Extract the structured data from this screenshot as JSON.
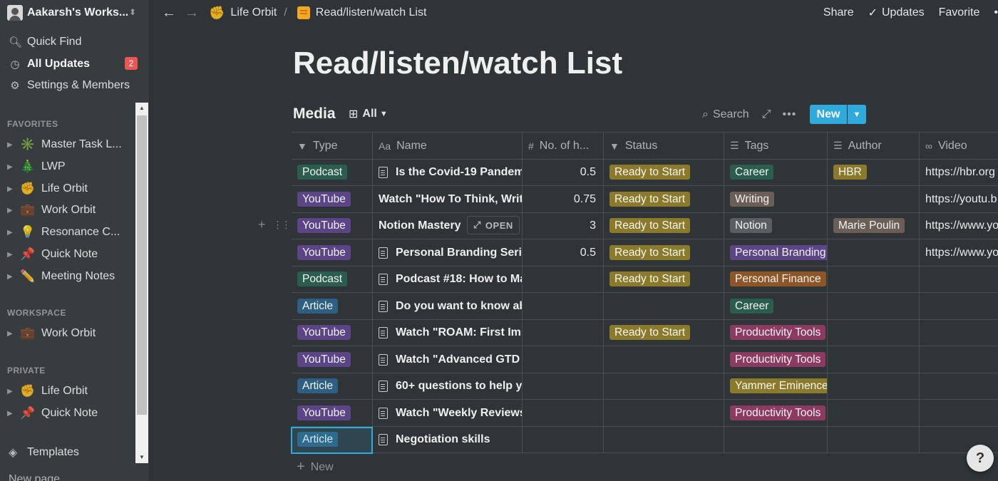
{
  "sidebar": {
    "workspace_name": "Aakarsh's Works...",
    "top_items": [
      {
        "label": "Quick Find",
        "icon": "search-icon"
      },
      {
        "label": "All Updates",
        "icon": "clock-icon",
        "badge": "2"
      },
      {
        "label": "Settings & Members",
        "icon": "gear-icon"
      }
    ],
    "favorites_label": "FAVORITES",
    "favorites": [
      {
        "emoji": "✳️",
        "label": "Master Task L..."
      },
      {
        "emoji": "🎄",
        "label": "LWP"
      },
      {
        "emoji": "✊",
        "label": "Life Orbit"
      },
      {
        "emoji": "💼",
        "label": "Work Orbit"
      },
      {
        "emoji": "💡",
        "label": "Resonance C..."
      },
      {
        "emoji": "📌",
        "label": "Quick Note"
      },
      {
        "emoji": "✏️",
        "label": "Meeting Notes"
      }
    ],
    "workspace_label": "WORKSPACE",
    "workspace_pages": [
      {
        "emoji": "💼",
        "label": "Work Orbit"
      }
    ],
    "private_label": "PRIVATE",
    "private_pages": [
      {
        "emoji": "✊",
        "label": "Life Orbit"
      },
      {
        "emoji": "📌",
        "label": "Quick Note"
      }
    ],
    "templates_label": "Templates",
    "new_page_label": "New page"
  },
  "topbar": {
    "breadcrumb_1": {
      "emoji": "✊",
      "label": "Life Orbit"
    },
    "separator": "/",
    "breadcrumb_2": {
      "label": "Read/listen/watch List"
    },
    "share": "Share",
    "updates": "Updates",
    "favorite": "Favorite",
    "more": "•"
  },
  "page": {
    "title": "Read/listen/watch List",
    "database_title": "Media",
    "view_name": "All",
    "search_label": "Search",
    "new_button": "New",
    "add_new_row": "New"
  },
  "table": {
    "columns": [
      {
        "label": "Type",
        "icon": "select-icon"
      },
      {
        "label": "Name",
        "icon": "text-icon"
      },
      {
        "label": "No. of h...",
        "icon": "number-icon"
      },
      {
        "label": "Status",
        "icon": "select-icon"
      },
      {
        "label": "Tags",
        "icon": "list-icon"
      },
      {
        "label": "Author",
        "icon": "list-icon"
      },
      {
        "label": "Video",
        "icon": "link-icon"
      }
    ],
    "open_label": "OPEN",
    "rows": [
      {
        "type": "Podcast",
        "name": "Is the Covid-19 Pandemi",
        "hours": "0.5",
        "status": "Ready to Start",
        "tags": "Career",
        "author": "HBR",
        "video": "https://hbr.org",
        "doc": true
      },
      {
        "type": "YouTube",
        "name": "Watch \"How To Think, Write",
        "hours": "0.75",
        "status": "Ready to Start",
        "tags": "Writing",
        "author": "",
        "video": "https://youtu.b",
        "doc": false
      },
      {
        "type": "YouTube",
        "name": "Notion Mastery",
        "hours": "3",
        "status": "Ready to Start",
        "tags": "Notion",
        "author": "Marie Poulin",
        "video": "https://www.yo",
        "doc": false
      },
      {
        "type": "YouTube",
        "name": "Personal Branding Series",
        "hours": "0.5",
        "status": "Ready to Start",
        "tags": "Personal Branding",
        "author": "",
        "video": "https://www.yo",
        "doc": true
      },
      {
        "type": "Podcast",
        "name": "Podcast #18: How to Ma",
        "hours": "",
        "status": "Ready to Start",
        "tags": "Personal Finance",
        "author": "",
        "video": "",
        "doc": true
      },
      {
        "type": "Article",
        "name": "Do you want to know ab",
        "hours": "",
        "status": "",
        "tags": "Career",
        "author": "",
        "video": "",
        "doc": true
      },
      {
        "type": "YouTube",
        "name": "Watch \"ROAM: First Imp",
        "hours": "",
        "status": "Ready to Start",
        "tags": "Productivity Tools",
        "author": "",
        "video": "",
        "doc": true
      },
      {
        "type": "YouTube",
        "name": "Watch \"Advanced GTD D",
        "hours": "",
        "status": "",
        "tags": "Productivity Tools",
        "author": "",
        "video": "",
        "doc": true
      },
      {
        "type": "Article",
        "name": "60+ questions to help yo",
        "hours": "",
        "status": "",
        "tags": "Yammer Eminence",
        "author": "",
        "video": "",
        "doc": true
      },
      {
        "type": "YouTube",
        "name": "Watch \"Weekly Reviews",
        "hours": "",
        "status": "",
        "tags": "Productivity Tools",
        "author": "",
        "video": "",
        "doc": true
      },
      {
        "type": "Article",
        "name": "Negotiation skills",
        "hours": "",
        "status": "",
        "tags": "",
        "author": "",
        "video": "",
        "doc": true
      }
    ]
  },
  "colors": {
    "Podcast": "#2b5d4e",
    "YouTube": "#5b4587",
    "Article": "#2e5f80",
    "Ready to Start": "#8c7a2c",
    "Career": "#2b5d4e",
    "Writing": "#6b5e57",
    "Notion": "#5a5e61",
    "Personal Branding": "#5b4587",
    "Personal Finance": "#8e5628",
    "Productivity Tools": "#8b3b62",
    "Yammer Eminence": "#8c7a2c",
    "HBR": "#8c7a2c",
    "Marie Poulin": "#6b5e57",
    "accent": "#2eaadc"
  },
  "help": "?"
}
